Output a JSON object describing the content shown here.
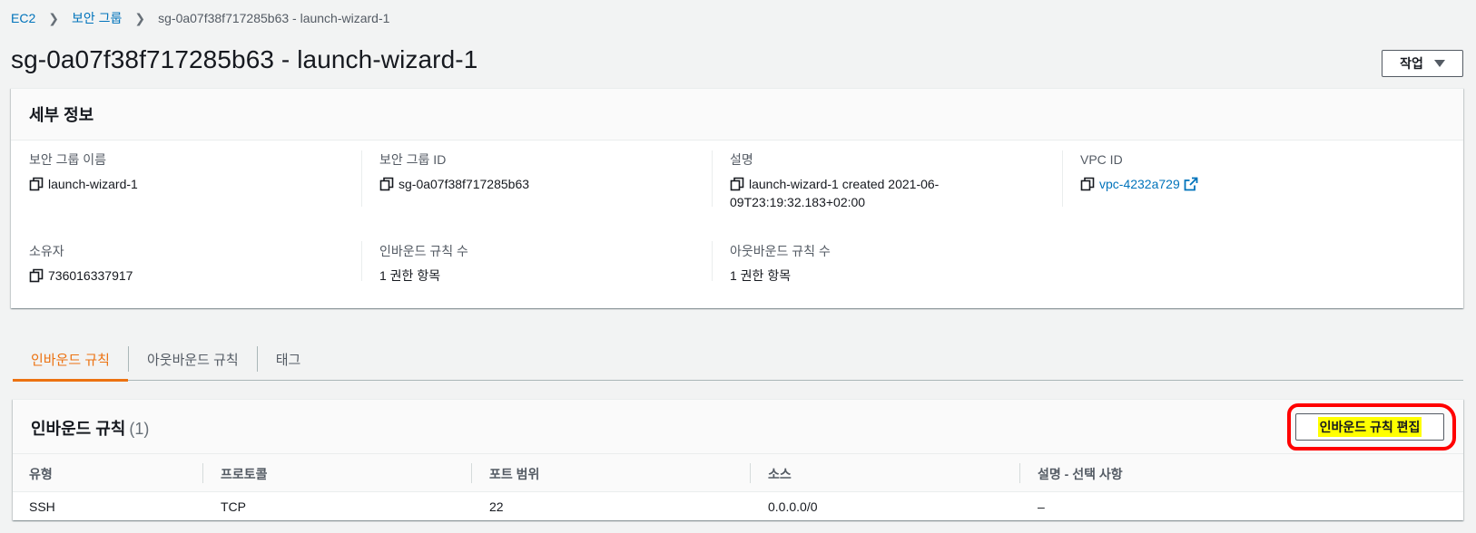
{
  "breadcrumb": {
    "items": [
      "EC2",
      "보안 그룹"
    ],
    "current": "sg-0a07f38f717285b63 - launch-wizard-1"
  },
  "page_title": "sg-0a07f38f717285b63 - launch-wizard-1",
  "actions_label": "작업",
  "details": {
    "title": "세부 정보",
    "sg_name_label": "보안 그룹 이름",
    "sg_name": "launch-wizard-1",
    "sg_id_label": "보안 그룹 ID",
    "sg_id": "sg-0a07f38f717285b63",
    "desc_label": "설명",
    "desc_line1": "launch-wizard-1 created 2021-06-",
    "desc_line2": "09T23:19:32.183+02:00",
    "vpc_label": "VPC ID",
    "vpc_id": "vpc-4232a729",
    "owner_label": "소유자",
    "owner": "736016337917",
    "inbound_count_label": "인바운드 규칙 수",
    "inbound_count": "1 권한 항목",
    "outbound_count_label": "아웃바운드 규칙 수",
    "outbound_count": "1 권한 항목"
  },
  "tabs": [
    "인바운드 규칙",
    "아웃바운드 규칙",
    "태그"
  ],
  "rules": {
    "title": "인바운드 규칙",
    "count": "(1)",
    "edit_label": "인바운드 규칙 편집",
    "columns": [
      "유형",
      "프로토콜",
      "포트 범위",
      "소스",
      "설명 - 선택 사항"
    ],
    "rows": [
      [
        "SSH",
        "TCP",
        "22",
        "0.0.0.0/0",
        "–"
      ]
    ]
  },
  "colors": {
    "link": "#0073bb",
    "active_tab": "#ec7211",
    "highlight": "#ffff00",
    "annotation": "#ff0000"
  }
}
